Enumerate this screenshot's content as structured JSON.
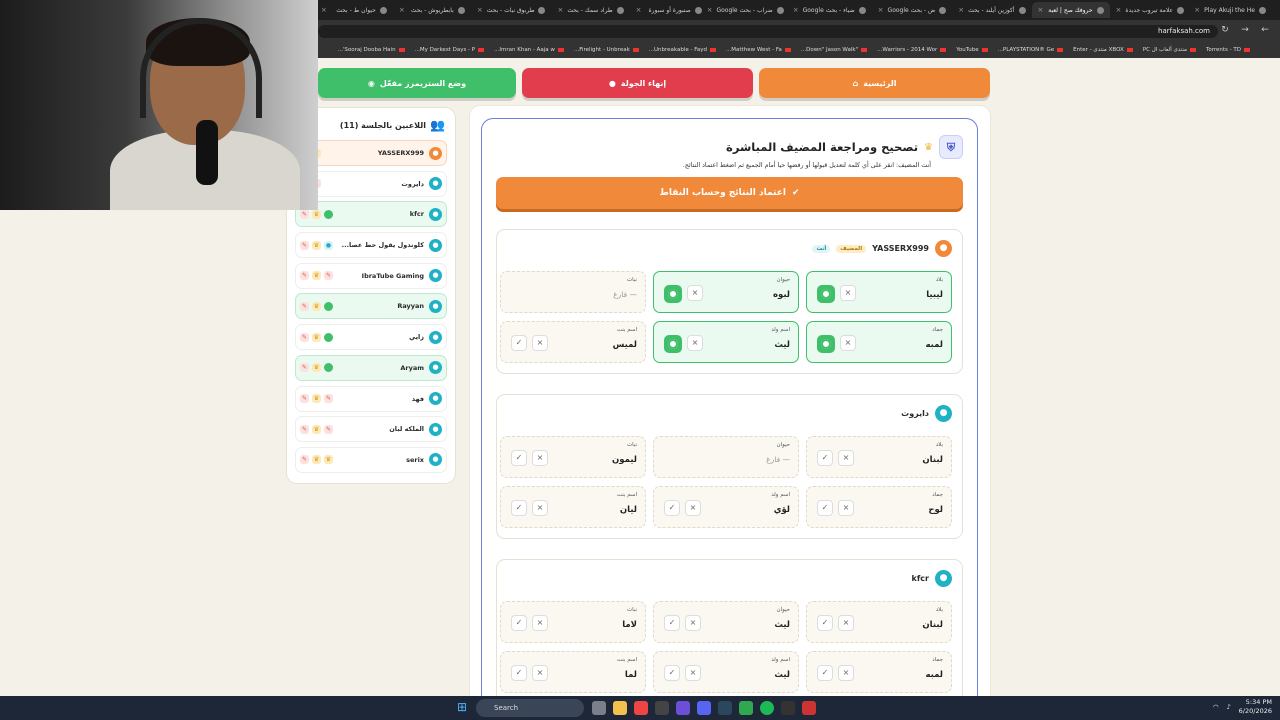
{
  "browser": {
    "tabs": [
      {
        "label": "Play Akuji the He"
      },
      {
        "label": "علامة تيروب جديدة"
      },
      {
        "label": "حروفك صح | لعبة"
      },
      {
        "label": "أكوزين أيلند - بحث"
      },
      {
        "label": "ض - بحث Google"
      },
      {
        "label": "ضياء - بحث Google"
      },
      {
        "label": "ضراب - بحث Google"
      },
      {
        "label": "صنبورة أو سبورة"
      },
      {
        "label": "طراد سمك - بحث"
      },
      {
        "label": "طربوق نبات - بحث"
      },
      {
        "label": "بابطريوش - بحث"
      },
      {
        "label": "حيوان ط - بحث"
      }
    ],
    "url": "harfaksah.com",
    "bookmarks": [
      "Torrents - TD",
      "منتدى ألعاب ال PC",
      "XBOX منتدى - Enter",
      "PLAYSTATION® Ge...",
      "YouTube",
      "Warriors - 2014 Wor...",
      "\"Down\" Jason Walk...",
      "Matthew West - Fa...",
      "Unbreakable - Fayd...",
      "Firelight - Unbreak...",
      "Imran Khan - Aaja w...",
      "My Darkest Days - P...",
      "Sooraj Dooba Hain'..."
    ]
  },
  "top_buttons": {
    "home": "الرئيسية",
    "end": "إنهاء الجولة",
    "stream": "وضع الستريمرز مفعّل"
  },
  "sidebar": {
    "title": "اللاعبين بالجلسة (11)",
    "players": [
      {
        "name": "YASSERX999",
        "style": "orange",
        "chips": [
          "y",
          "d"
        ]
      },
      {
        "name": "دايروت",
        "style": "plain",
        "chips": [
          "p",
          "y"
        ]
      },
      {
        "name": "kfcr",
        "style": "green",
        "chips": [
          "g",
          "y",
          "p"
        ]
      },
      {
        "name": "كلوندول يقول حط عصا...",
        "style": "plain",
        "chips": [
          "d",
          "y",
          "p"
        ]
      },
      {
        "name": "IbraTube Gaming",
        "style": "plain",
        "chips": [
          "p",
          "y",
          "p"
        ]
      },
      {
        "name": "Rayyan",
        "style": "green",
        "chips": [
          "g",
          "y",
          "p"
        ]
      },
      {
        "name": "زايي",
        "style": "plain",
        "chips": [
          "g",
          "y",
          "p"
        ]
      },
      {
        "name": "Aryam",
        "style": "green",
        "chips": [
          "g",
          "y",
          "p"
        ]
      },
      {
        "name": "فهد",
        "style": "plain",
        "chips": [
          "p",
          "y",
          "p"
        ]
      },
      {
        "name": "الملكه لبان",
        "style": "plain",
        "chips": [
          "p",
          "y",
          "p"
        ]
      },
      {
        "name": "serix",
        "style": "plain",
        "chips": [
          "y",
          "y",
          "p"
        ]
      }
    ]
  },
  "main": {
    "title": "تصحيح ومراجعة المضيف المباشرة",
    "subtitle": "أنت المضيف: انقر على أي كلمة لتعديل قبولها أو رفضها حيا أمام الجميع ثم اضغط اعتماد النتائج.",
    "approve_label": "اعتماد النتائج وحساب النقاط",
    "players": [
      {
        "name": "YASSERX999",
        "tags": [
          "المضيف",
          "أنت"
        ],
        "avatar": "o",
        "cells": [
          {
            "cat": "بلاد",
            "ans": "ليبيا",
            "state": "ok"
          },
          {
            "cat": "حيوان",
            "ans": "لبوه",
            "state": "ok"
          },
          {
            "cat": "نبات",
            "ans": "— فارغ",
            "state": "empty"
          },
          {
            "cat": "جماد",
            "ans": "لمبه",
            "state": "ok"
          },
          {
            "cat": "اسم ولد",
            "ans": "ليث",
            "state": "ok"
          },
          {
            "cat": "اسم بنت",
            "ans": "لميس",
            "state": "plain"
          }
        ]
      },
      {
        "name": "دايروت",
        "tags": [],
        "avatar": "b",
        "cells": [
          {
            "cat": "بلاد",
            "ans": "لبنان",
            "state": "plain"
          },
          {
            "cat": "حيوان",
            "ans": "— فارغ",
            "state": "empty"
          },
          {
            "cat": "نبات",
            "ans": "ليمون",
            "state": "plain"
          },
          {
            "cat": "جماد",
            "ans": "لوح",
            "state": "plain"
          },
          {
            "cat": "اسم ولد",
            "ans": "لؤي",
            "state": "plain"
          },
          {
            "cat": "اسم بنت",
            "ans": "ليان",
            "state": "plain"
          }
        ]
      },
      {
        "name": "kfcr",
        "tags": [],
        "avatar": "b",
        "cells": [
          {
            "cat": "بلاد",
            "ans": "لبنان",
            "state": "plain"
          },
          {
            "cat": "حيوان",
            "ans": "ليث",
            "state": "plain"
          },
          {
            "cat": "نبات",
            "ans": "لاما",
            "state": "plain"
          },
          {
            "cat": "جماد",
            "ans": "لمبه",
            "state": "plain"
          },
          {
            "cat": "اسم ولد",
            "ans": "ليث",
            "state": "plain"
          },
          {
            "cat": "اسم بنت",
            "ans": "لما",
            "state": "plain"
          }
        ]
      }
    ]
  },
  "taskbar": {
    "search": "Search",
    "time": "5:34 PM",
    "date": "6/20/2026"
  }
}
